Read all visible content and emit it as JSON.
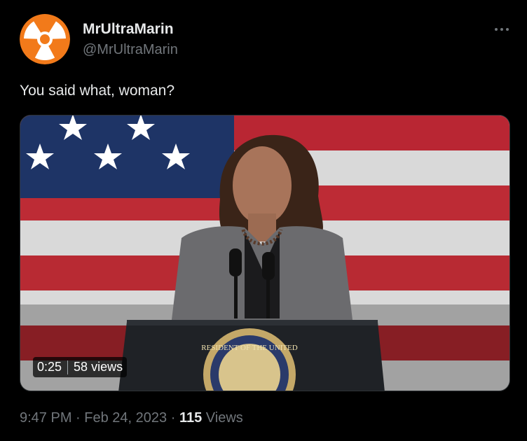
{
  "author": {
    "display_name": "MrUltraMarin",
    "handle": "@MrUltraMarin"
  },
  "tweet": {
    "text": "You said what, woman?"
  },
  "video": {
    "duration": "0:25",
    "views": "58 views"
  },
  "meta": {
    "time": "9:47 PM",
    "separator": "·",
    "date": "Feb 24, 2023",
    "view_count": "115",
    "views_label": "Views"
  },
  "podium_seal_text": "RESIDENT OF THE UNITED",
  "colors": {
    "background": "#000000",
    "primary_text": "#e7e9ea",
    "secondary_text": "#71767b",
    "avatar_orange": "#f27a1a"
  },
  "icons": {
    "more": "more-horizontal-icon",
    "avatar": "radiation-symbol-avatar"
  }
}
